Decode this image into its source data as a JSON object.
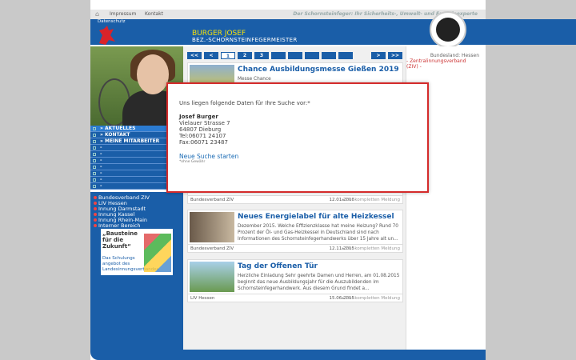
{
  "topbar": {
    "links": [
      "Impressum",
      "Kontakt"
    ],
    "tagline": "Der Schornsteinfeger: Ihr Sicherheits-, Umwelt- und Energieexperte",
    "datenschutz": "Datenschutz"
  },
  "header": {
    "name": "BURGER JOSEF",
    "subtitle": "BEZ.-SCHORNSTEINFEGERMEISTER"
  },
  "nav": {
    "items": [
      "AKTUELLES",
      "KONTAKT",
      "MEINE MITARBEITER",
      "-",
      "-",
      "-",
      "-",
      "-",
      "-",
      "-"
    ]
  },
  "links": [
    "Bundesverband ZIV",
    "LIV Hessen",
    "Innung Darmstadt",
    "Innung Kassel",
    "Innung Rhein-Main",
    "Interner Bereich"
  ],
  "promo": {
    "title": "„Bausteine für die Zukunft“",
    "subtitle": "Das Schulungs angebot des Landesinnungsverbandes"
  },
  "pager": [
    "<<",
    "<",
    "1",
    "2",
    "3",
    "",
    "",
    "",
    "",
    "",
    ">",
    ">>"
  ],
  "cards": [
    {
      "title": "Chance Ausbildungsmesse Gießen 2019",
      "text": "Messe Chance",
      "source": "",
      "date": "",
      "more": ""
    },
    {
      "title": "",
      "text": "",
      "source": "Bundesverband ZIV",
      "date": "12.01.2016",
      "more": "Zur kompletten Meldung"
    },
    {
      "title": "Neues Energielabel für alte Heizkessel",
      "text": "Dezember 2015. Welche Effizienzklasse hat meine Heizung? Rund 70 Prozent der Öl- und Gas-Heizkessel in Deutschland sind nach Informationen des Schornsteinfegerhandwerks über 15 Jahre alt un...",
      "source": "Bundesverband ZIV",
      "date": "12.11.2015",
      "more": "Zur kompletten Meldung"
    },
    {
      "title": "Tag der Offenen Tür",
      "text": "Herzliche Einladung Sehr geehrte Damen und Herren, am 01.08.2015 beginnt das neue Ausbildungsjahr für die Auszubildenden im Schornsteinfegerhandwerk. Aus diesem Grund findet a...",
      "source": "LIV Hessen",
      "date": "15.06.2015",
      "more": "Zur kompletten Meldung"
    }
  ],
  "right": {
    "state_label": "Bundesland: Hessen",
    "association": "- Zentralinnungsverband (ZIV) -"
  },
  "modal": {
    "intro": "Uns liegen folgende Daten für Ihre Suche vor:*",
    "name": "Josef Burger",
    "street": "Vielauer Strasse 7",
    "city": "64807 Dieburg",
    "tel": "Tel:06071 24107",
    "fax": "Fax:06071 23487",
    "new_search": "Neue Suche starten",
    "note": "*ohne Gewähr"
  }
}
